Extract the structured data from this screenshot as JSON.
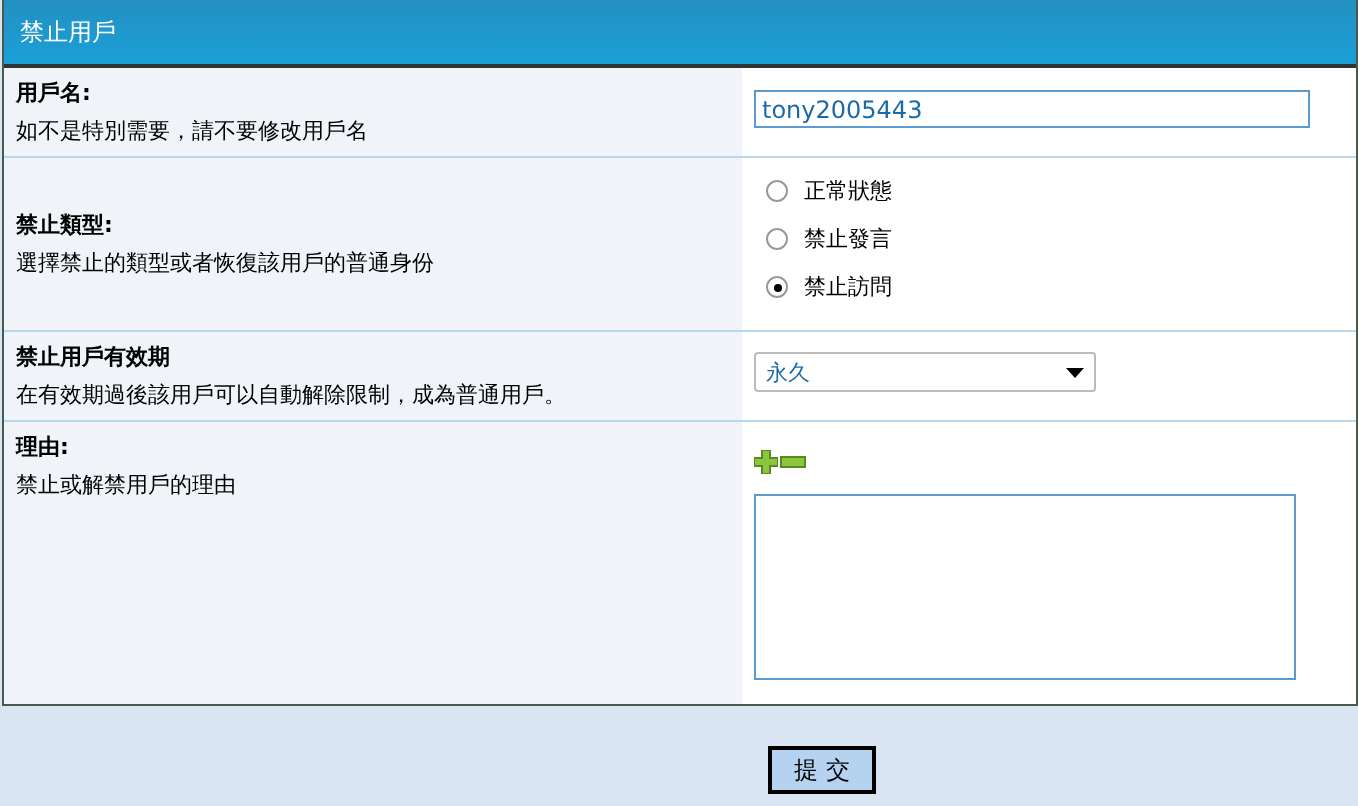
{
  "header": {
    "title": "禁止用戶"
  },
  "fields": [
    {
      "kind": "text",
      "label": "用戶名:",
      "hint": "如不是特別需要，請不要修改用戶名",
      "value": "tony2005443"
    },
    {
      "kind": "radio",
      "label": "禁止類型:",
      "hint": "選擇禁止的類型或者恢復該用戶的普通身份",
      "options": [
        {
          "label": "正常狀態",
          "selected": false
        },
        {
          "label": "禁止發言",
          "selected": false
        },
        {
          "label": "禁止訪問",
          "selected": true
        }
      ]
    },
    {
      "kind": "select",
      "label": "禁止用戶有效期",
      "hint": "在有效期過後該用戶可以自動解除限制，成為普通用戶。",
      "value": "永久"
    },
    {
      "kind": "textarea",
      "label": "理由:",
      "hint": "禁止或解禁用戶的理由"
    }
  ],
  "submit": {
    "label": "提 交"
  }
}
